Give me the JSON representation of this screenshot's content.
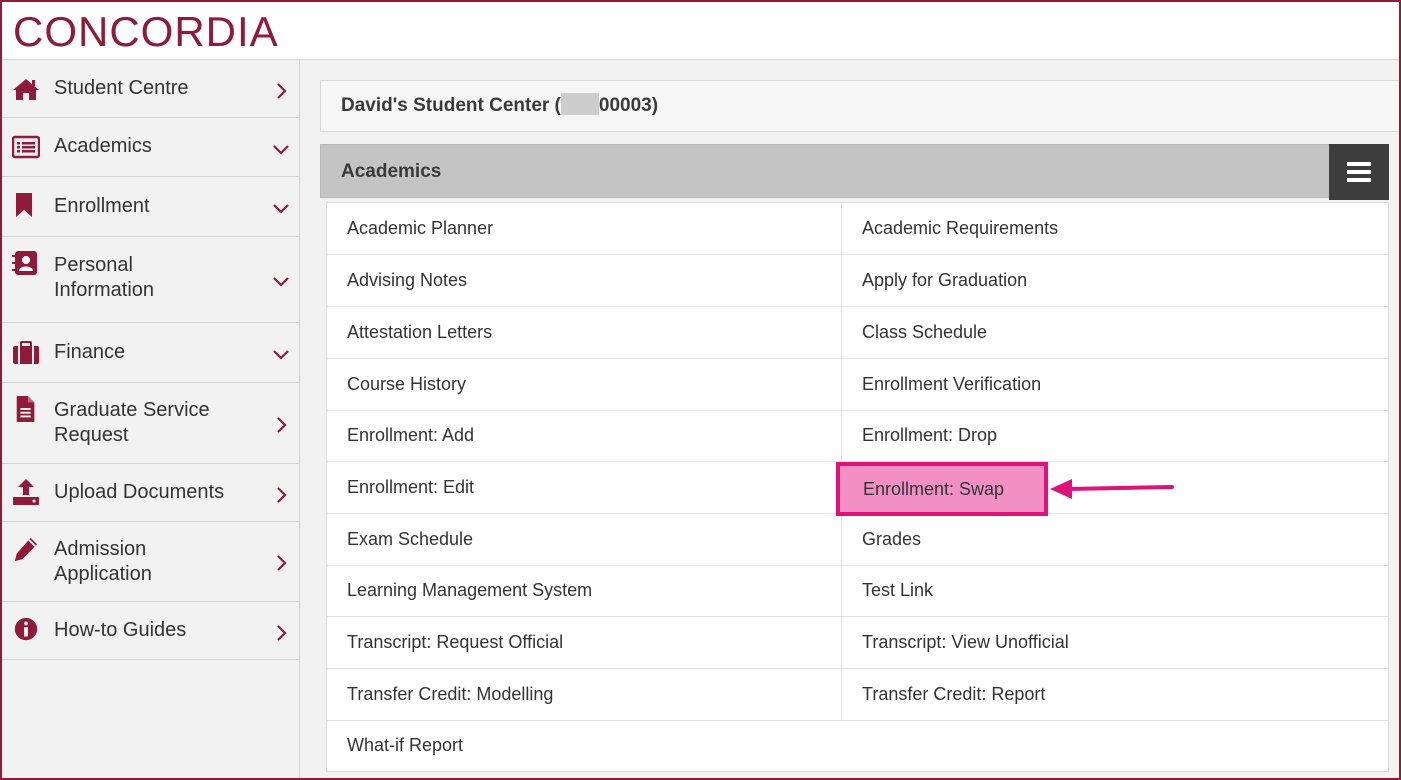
{
  "brand": {
    "logo_text": "CONCORDIA",
    "color": "#8f1a3a"
  },
  "sidebar": {
    "items": [
      {
        "label": "Student Centre",
        "icon": "home-icon",
        "chevron": "right"
      },
      {
        "label": "Academics",
        "icon": "list-card-icon",
        "chevron": "down"
      },
      {
        "label": "Enrollment",
        "icon": "bookmark-icon",
        "chevron": "down"
      },
      {
        "label": "Personal Information",
        "icon": "address-book-icon",
        "chevron": "down"
      },
      {
        "label": "Finance",
        "icon": "briefcase-icon",
        "chevron": "down"
      },
      {
        "label": "Graduate Service Request",
        "icon": "document-icon",
        "chevron": "right"
      },
      {
        "label": "Upload Documents",
        "icon": "upload-icon",
        "chevron": "right"
      },
      {
        "label": "Admission Application",
        "icon": "pencil-icon",
        "chevron": "right"
      },
      {
        "label": "How-to Guides",
        "icon": "info-icon",
        "chevron": "right"
      }
    ]
  },
  "student_center": {
    "title_prefix": "David's Student Center (",
    "id_suffix": "00003)"
  },
  "academics": {
    "title": "Academics",
    "links_left": [
      "Academic Planner",
      "Advising Notes",
      "Attestation Letters",
      "Course History",
      "Enrollment: Add",
      "Enrollment: Edit",
      "Exam Schedule",
      "Learning Management System",
      "Transcript: Request Official",
      "Transfer Credit: Modelling",
      "What-if Report"
    ],
    "links_right": [
      "Academic Requirements",
      "Apply for Graduation",
      "Class Schedule",
      "Enrollment Verification",
      "Enrollment: Drop",
      "Enrollment: Swap",
      "Grades",
      "Test Link",
      "Transcript: View Unofficial",
      "Transfer Credit: Report",
      ""
    ],
    "highlighted": "Enrollment: Swap",
    "highlight_color": "#e0127a"
  }
}
